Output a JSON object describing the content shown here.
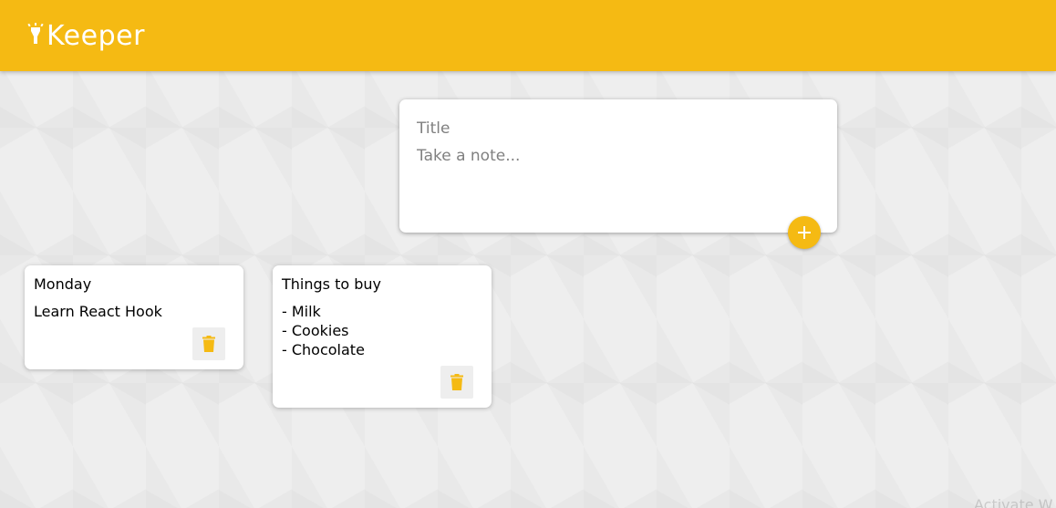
{
  "header": {
    "logo_text": "Keeper",
    "logo_icon": "highlight-icon",
    "background_color": "#f5ba13"
  },
  "create_note": {
    "title_placeholder": "Title",
    "content_placeholder": "Take a note...",
    "add_icon": "plus-icon"
  },
  "notes": [
    {
      "title": "Monday",
      "content_lines": [
        "Learn React Hook"
      ],
      "delete_icon": "trash-icon"
    },
    {
      "title": "Things to buy",
      "content_lines": [
        "- Milk",
        "- Cookies",
        "- Chocolate"
      ],
      "delete_icon": "trash-icon"
    }
  ],
  "watermark": {
    "text": "Activate W"
  },
  "colors": {
    "accent": "#f5ba13",
    "background": "#eeeeee",
    "card": "#ffffff"
  }
}
